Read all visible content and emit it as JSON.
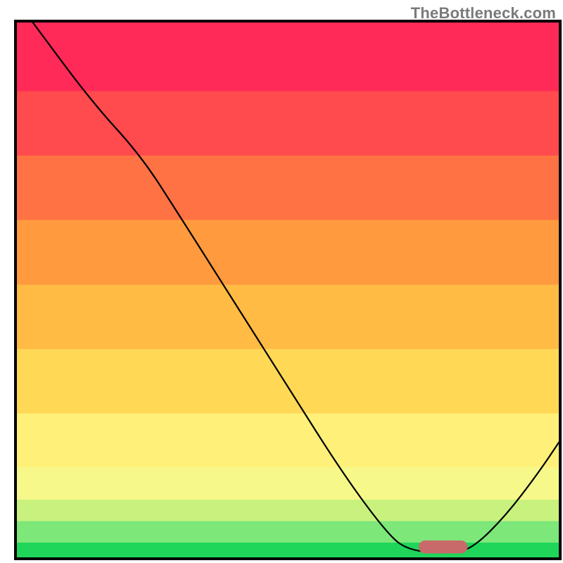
{
  "watermark": "TheBottleneck.com",
  "chart_data": {
    "type": "line",
    "title": "",
    "xlabel": "",
    "ylabel": "",
    "xlim": [
      0,
      100
    ],
    "ylim": [
      0,
      100
    ],
    "background_bands": [
      {
        "y": 0,
        "height": 3,
        "color": "#1fd65a"
      },
      {
        "y": 3,
        "height": 4,
        "color": "#7de77a"
      },
      {
        "y": 7,
        "height": 4,
        "color": "#c8f27d"
      },
      {
        "y": 11,
        "height": 6,
        "color": "#f6f88a"
      },
      {
        "y": 17,
        "height": 10,
        "color": "#fff07a"
      },
      {
        "y": 27,
        "height": 12,
        "color": "#ffd956"
      },
      {
        "y": 39,
        "height": 12,
        "color": "#ffbb44"
      },
      {
        "y": 51,
        "height": 12,
        "color": "#ff9a3f"
      },
      {
        "y": 63,
        "height": 12,
        "color": "#ff7243"
      },
      {
        "y": 75,
        "height": 12,
        "color": "#ff4a4e"
      },
      {
        "y": 87,
        "height": 13,
        "color": "#ff2a57"
      }
    ],
    "series": [
      {
        "name": "curve",
        "stroke": "#000000",
        "stroke_width": 2.2,
        "points": [
          {
            "x": 3,
            "y": 100
          },
          {
            "x": 14,
            "y": 85
          },
          {
            "x": 23,
            "y": 75
          },
          {
            "x": 30,
            "y": 64
          },
          {
            "x": 40,
            "y": 48
          },
          {
            "x": 50,
            "y": 32
          },
          {
            "x": 60,
            "y": 16
          },
          {
            "x": 68,
            "y": 5
          },
          {
            "x": 72,
            "y": 1.5
          },
          {
            "x": 80,
            "y": 1
          },
          {
            "x": 84,
            "y": 2
          },
          {
            "x": 90,
            "y": 8
          },
          {
            "x": 96,
            "y": 16
          },
          {
            "x": 100,
            "y": 22
          }
        ]
      }
    ],
    "optimal_marker": {
      "x_start": 74,
      "x_end": 83,
      "y": 1,
      "color": "#c96a6a",
      "height": 2.4
    },
    "frame_color": "#000000",
    "frame_width": 4
  }
}
